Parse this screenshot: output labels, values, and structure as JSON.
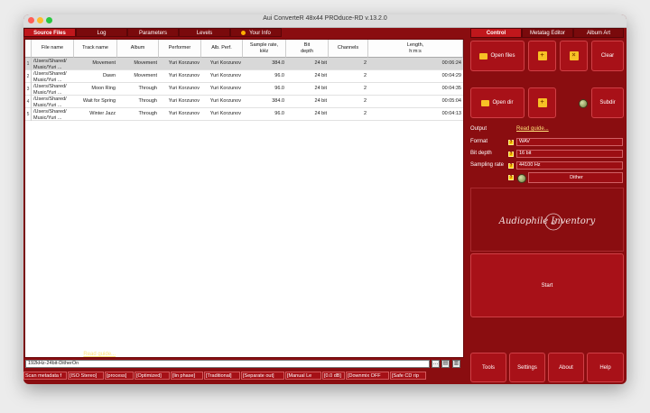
{
  "window": {
    "title": "Aui ConverteR 48x44 PROduce-RD v.13.2.0"
  },
  "left_tabs": [
    "Source Files",
    "Log",
    "Parameters",
    "Levels",
    "Your Info"
  ],
  "table": {
    "columns": [
      "File name",
      "Track name",
      "Album",
      "Performer",
      "Alb. Perf.",
      "Sample rate,\nkHz",
      "Bit\ndepth",
      "Channels",
      "Length,\nh:m:s"
    ],
    "rows": [
      {
        "marker": "1",
        "file": "/Users/Shared/\nMusic/Yuri ...",
        "track": "Movement",
        "album": "Movement",
        "performer": "Yuri Korzunov",
        "alb_perf": "Yuri Korzunov",
        "rate": "384.0",
        "bits": "24 bit",
        "ch": "2",
        "len": "00:06:24"
      },
      {
        "marker": "2",
        "file": "/Users/Shared/\nMusic/Yuri ...",
        "track": "Dawn",
        "album": "Movement",
        "performer": "Yuri Korzunov",
        "alb_perf": "Yuri Korzunov",
        "rate": "96.0",
        "bits": "24 bit",
        "ch": "2",
        "len": "00:04:29"
      },
      {
        "marker": "3",
        "file": "/Users/Shared/\nMusic/Yuri ...",
        "track": "Moon Ring",
        "album": "Through",
        "performer": "Yuri Korzunov",
        "alb_perf": "Yuri Korzunov",
        "rate": "96.0",
        "bits": "24 bit",
        "ch": "2",
        "len": "00:04:35"
      },
      {
        "marker": "4",
        "file": "/Users/Shared/\nMusic/Yuri ...",
        "track": "Wait for Spring",
        "album": "Through",
        "performer": "Yuri Korzunov",
        "alb_perf": "Yuri Korzunov",
        "rate": "384.0",
        "bits": "24 bit",
        "ch": "2",
        "len": "00:05:04"
      },
      {
        "marker": "5",
        "file": "/Users/Shared/\nMusic/Yuri ...",
        "track": "Winter Jazz",
        "album": "Through",
        "performer": "Yuri Korzunov",
        "alb_perf": "Yuri Korzunov",
        "rate": "96.0",
        "bits": "24 bit",
        "ch": "2",
        "len": "00:04:13"
      }
    ]
  },
  "output_dir": {
    "label": "Directory of output files",
    "guide": "Read guide...",
    "value": "192kHz-24bit-DitherOn"
  },
  "status_chips": [
    "Scan metadata f",
    "[ISO Stereo]",
    "[process]",
    "[Optimized]",
    "[lin phase]",
    "[Traditional]",
    "[Separate out]",
    "[Manual Le",
    "[0.0 dB]",
    "[Downmix OFF",
    "[Safe CD rip"
  ],
  "right_tabs": [
    "Control",
    "Metatag Editor",
    "Album Art"
  ],
  "controls": {
    "open_files": "Open files",
    "open_dir": "Open dir",
    "clear": "Clear",
    "subdir": "Subdir",
    "output_label": "Output",
    "output_guide": "Read guide...",
    "format_label": "Format",
    "format_value": "WAV",
    "bitdepth_label": "Bit depth",
    "bitdepth_value": "16 bit",
    "samplerate_label": "Sampling rate",
    "samplerate_value": "44100 Hz",
    "dither": "Dither",
    "logo_text": "Audiophile Inventory",
    "start": "Start",
    "tools": "Tools",
    "settings": "Settings",
    "about": "About",
    "help": "Help"
  },
  "colors": {
    "accent": "#c0171c",
    "panel": "#8a0d10",
    "icon_yellow": "#f7c125"
  }
}
